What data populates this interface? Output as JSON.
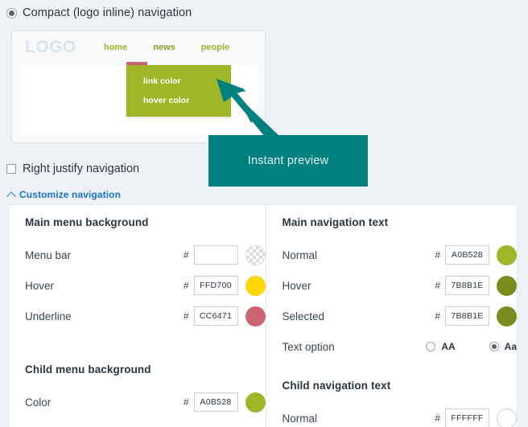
{
  "layout_option": {
    "label": "Compact (logo inline) navigation",
    "selected": true
  },
  "preview": {
    "logo_text": "LOGO",
    "nav_links": [
      {
        "label": "home",
        "state": "normal"
      },
      {
        "label": "news",
        "state": "selected"
      },
      {
        "label": "people",
        "state": "normal"
      }
    ],
    "child_menu": {
      "items": [
        "link color",
        "hover color"
      ],
      "background": "#A0B528",
      "text_color": "#FFFFFF"
    },
    "underline_color": "#CC6471"
  },
  "callout": {
    "text": "Instant preview",
    "color": "#018080"
  },
  "right_justify": {
    "label": "Right justify navigation",
    "checked": false
  },
  "customize_link": {
    "label": "Customize navigation",
    "icon": "chevron-up-icon",
    "expanded": true,
    "color": "#1A73C8"
  },
  "panel": {
    "left": [
      {
        "title": "Main menu background",
        "fields": [
          {
            "name": "Menu bar",
            "hash": "#",
            "value": "",
            "swatch": "transparent"
          },
          {
            "name": "Hover",
            "hash": "#",
            "value": "FFD700",
            "swatch": "#FFD700"
          },
          {
            "name": "Underline",
            "hash": "#",
            "value": "CC6471",
            "swatch": "#CC6471"
          }
        ]
      },
      {
        "title": "Child menu background",
        "fields": [
          {
            "name": "Color",
            "hash": "#",
            "value": "A0B528",
            "swatch": "#A0B528"
          }
        ]
      }
    ],
    "right": [
      {
        "title": "Main navigation text",
        "fields": [
          {
            "name": "Normal",
            "hash": "#",
            "value": "A0B528",
            "swatch": "#A0B528"
          },
          {
            "name": "Hover",
            "hash": "#",
            "value": "7B8B1E",
            "swatch": "#7B8B1E"
          },
          {
            "name": "Selected",
            "hash": "#",
            "value": "7B8B1E",
            "swatch": "#7B8B1E"
          }
        ],
        "text_option": {
          "name": "Text option",
          "options": [
            {
              "label": "AA",
              "selected": false
            },
            {
              "label": "Aa",
              "selected": true
            }
          ]
        }
      },
      {
        "title": "Child navigation text",
        "fields": [
          {
            "name": "Normal",
            "hash": "#",
            "value": "FFFFFF",
            "swatch": "#FFFFFF"
          }
        ]
      }
    ]
  }
}
